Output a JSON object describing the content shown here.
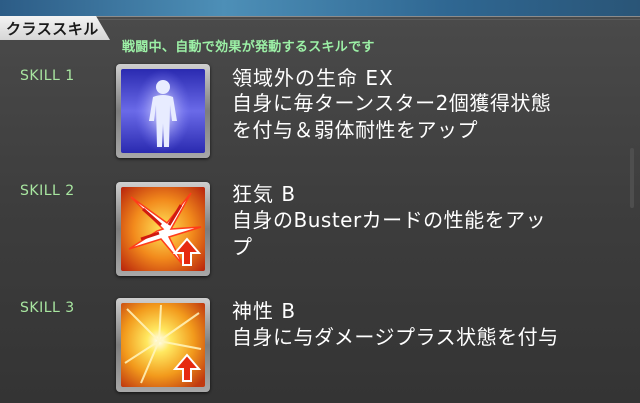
{
  "header": {
    "title": "クラススキル",
    "subtitle": "戦闘中、自動で効果が発動するスキルです"
  },
  "skills": [
    {
      "slot_label": "SKILL 1",
      "name": "領域外の生命 EX",
      "description_line1": "自身に毎ターンスター2個獲得状態",
      "description_line2": "を付与＆弱体耐性をアップ",
      "icon": "glowing-figure-icon"
    },
    {
      "slot_label": "SKILL 2",
      "name": "狂気 B",
      "description_line1": "自身のBusterカードの性能をアッ",
      "description_line2": "プ",
      "icon": "buster-up-icon"
    },
    {
      "slot_label": "SKILL 3",
      "name": "神性 B",
      "description_line1": "自身に与ダメージプラス状態を付与",
      "description_line2": "",
      "icon": "damage-plus-icon"
    }
  ],
  "colors": {
    "subtitle": "#9cf0a6",
    "skill_label": "#a8e6a0",
    "panel": "#3d3d3d",
    "header_tab": "#e6e6e6"
  }
}
